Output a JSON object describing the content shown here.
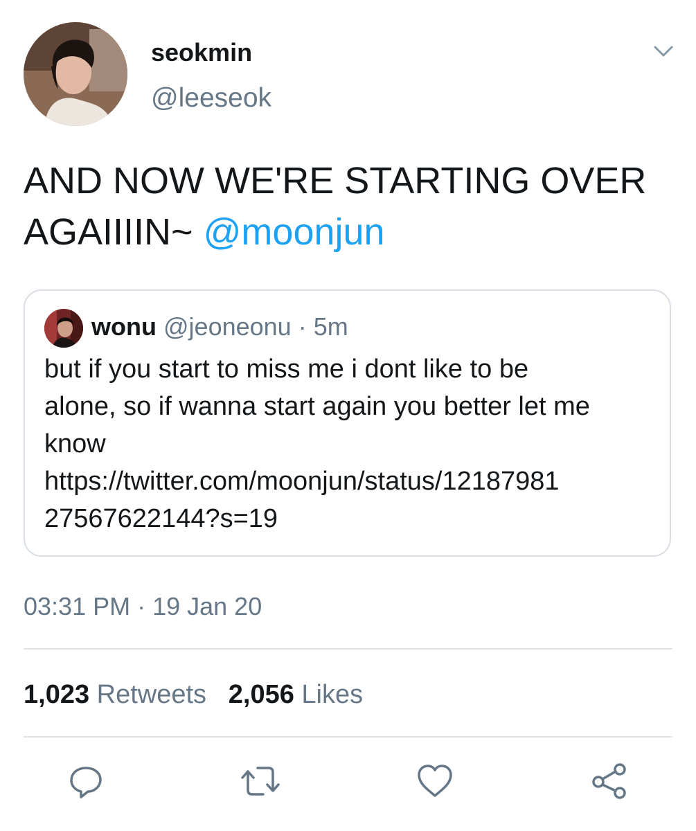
{
  "author": {
    "display_name": "seokmin",
    "handle": "@leeseok"
  },
  "tweet": {
    "text": "AND NOW WE'RE STARTING OVER AGAIIIIN~",
    "mention": "@moonjun"
  },
  "quote": {
    "name": "wonu",
    "handle": "@jeoneonu",
    "dot": "·",
    "time": "5m",
    "text_line1": "but if you start to miss me i dont like to be",
    "text_line2": "alone, so if wanna start again you better let me",
    "text_line3": "know",
    "text_line4": "https://twitter.com/moonjun/status/12187981",
    "text_line5": "27567622144?s=19"
  },
  "timestamp": "03:31 PM · 19 Jan 20",
  "stats": {
    "retweets_count": "1,023",
    "retweets_label": "Retweets",
    "likes_count": "2,056",
    "likes_label": "Likes"
  },
  "actions": {
    "icons": [
      "reply-icon",
      "retweet-icon",
      "like-icon",
      "share-icon"
    ]
  },
  "colors": {
    "link": "#1da1f2",
    "secondary_text": "#657786",
    "primary_text": "#14171a",
    "border": "#d8dee3"
  }
}
